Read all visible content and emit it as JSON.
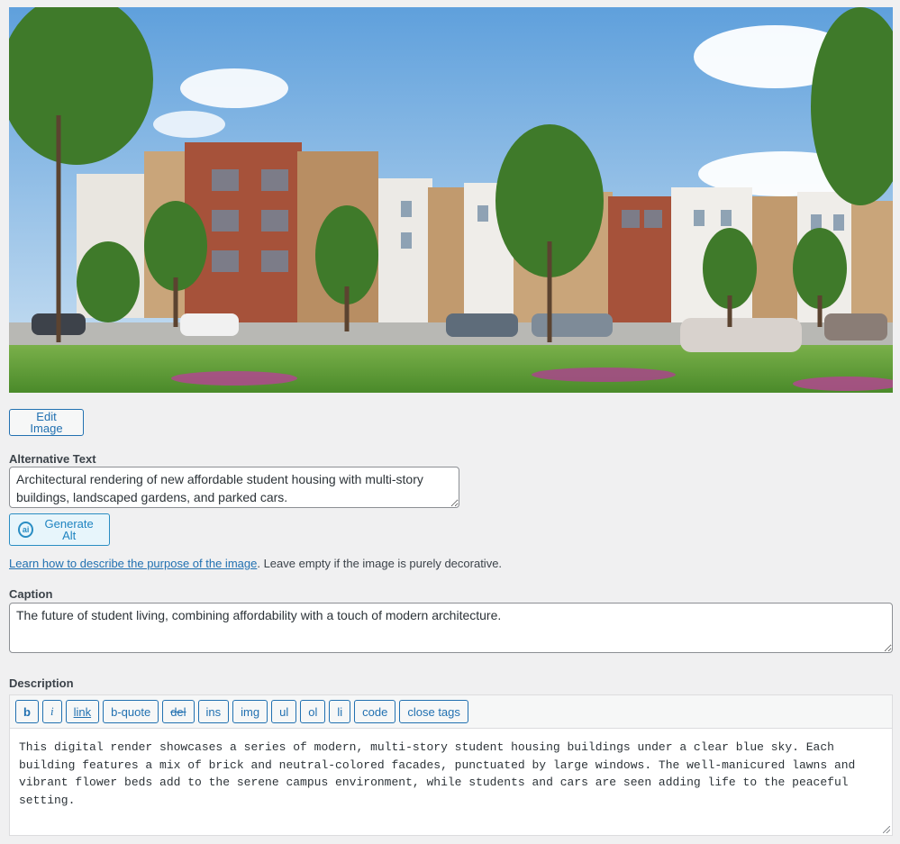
{
  "image": {
    "alt": "Architectural rendering of new affordable student housing with multi-story buildings, landscaped gardens, and parked cars."
  },
  "edit_button": "Edit Image",
  "alt_text": {
    "label": "Alternative Text",
    "value": "Architectural rendering of new affordable student housing with multi-story buildings, landscaped gardens, and parked cars."
  },
  "generate_alt": {
    "label": "Generate Alt",
    "icon": "ai-icon"
  },
  "help": {
    "link_text": "Learn how to describe the purpose of the image",
    "suffix": ". Leave empty if the image is purely decorative."
  },
  "caption": {
    "label": "Caption",
    "value": "The future of student living, combining affordability with a touch of modern architecture."
  },
  "description": {
    "label": "Description",
    "toolbar": [
      "b",
      "i",
      "link",
      "b-quote",
      "del",
      "ins",
      "img",
      "ul",
      "ol",
      "li",
      "code",
      "close tags"
    ],
    "value": "This digital render showcases a series of modern, multi-story student housing buildings under a clear blue sky. Each building features a mix of brick and neutral-colored facades, punctuated by large windows. The well-manicured lawns and vibrant flower beds add to the serene campus environment, while students and cars are seen adding life to the peaceful setting."
  },
  "colors": {
    "accent": "#2271b1",
    "background": "#f0f0f1"
  }
}
